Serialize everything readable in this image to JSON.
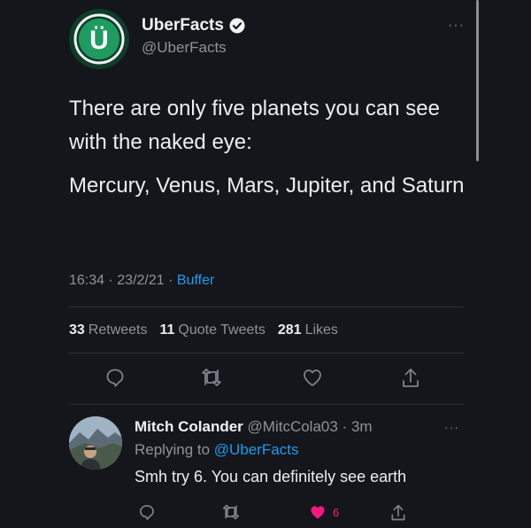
{
  "tweet": {
    "author_name": "UberFacts",
    "author_handle": "@UberFacts",
    "more": "···",
    "text_p1": "There are only five planets you can see with the naked eye:",
    "text_p2": "Mercury, Venus, Mars, Jupiter, and Saturn",
    "time": "16:34",
    "date": "23/2/21",
    "source": "Buffer",
    "stats": {
      "retweets_count": "33",
      "retweets_label": "Retweets",
      "quotes_count": "11",
      "quotes_label": "Quote Tweets",
      "likes_count": "281",
      "likes_label": "Likes"
    },
    "avatar_logo_letter": "Ü"
  },
  "reply": {
    "author_name": "Mitch Colander",
    "author_handle": "@MitcCola03",
    "age": "3m",
    "replying_prefix": "Replying to",
    "replying_to": "@UberFacts",
    "text": "Smh try 6. You can definitely see earth",
    "like_count": "6",
    "more": "···"
  },
  "separators": {
    "dot": "·"
  },
  "colors": {
    "background": "#15161b",
    "link": "#1d9bf0",
    "like": "#f91880",
    "brand_green": "#1f9b5f"
  },
  "icons": [
    "verified-icon",
    "more-icon",
    "reply-icon",
    "retweet-icon",
    "like-icon",
    "share-icon"
  ]
}
